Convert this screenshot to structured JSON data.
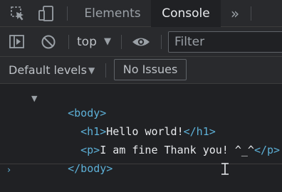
{
  "tabs": {
    "elements": "Elements",
    "console": "Console",
    "more": "»"
  },
  "toolbar": {
    "context": "top",
    "filter_placeholder": "Filter"
  },
  "levels_bar": {
    "levels_label": "Default levels",
    "issues_label": "No Issues"
  },
  "console": {
    "body_open": "<body>",
    "h1_open": "<h1>",
    "h1_text": "Hello world!",
    "h1_close": "</h1>",
    "p_open": "<p>",
    "p_text": "I am fine Thank you! ^_^",
    "p_close": "</p>",
    "body_close": "</body>"
  },
  "colors": {
    "background": "#202124",
    "toolbar": "#292a2d",
    "tag": "#5db0d7",
    "text": "#e8eaed"
  },
  "icons": [
    "inspect-cursor-icon",
    "device-toggle-icon",
    "sidebar-toggle-icon",
    "clear-console-icon",
    "eye-icon",
    "expand-triangle-icon"
  ]
}
